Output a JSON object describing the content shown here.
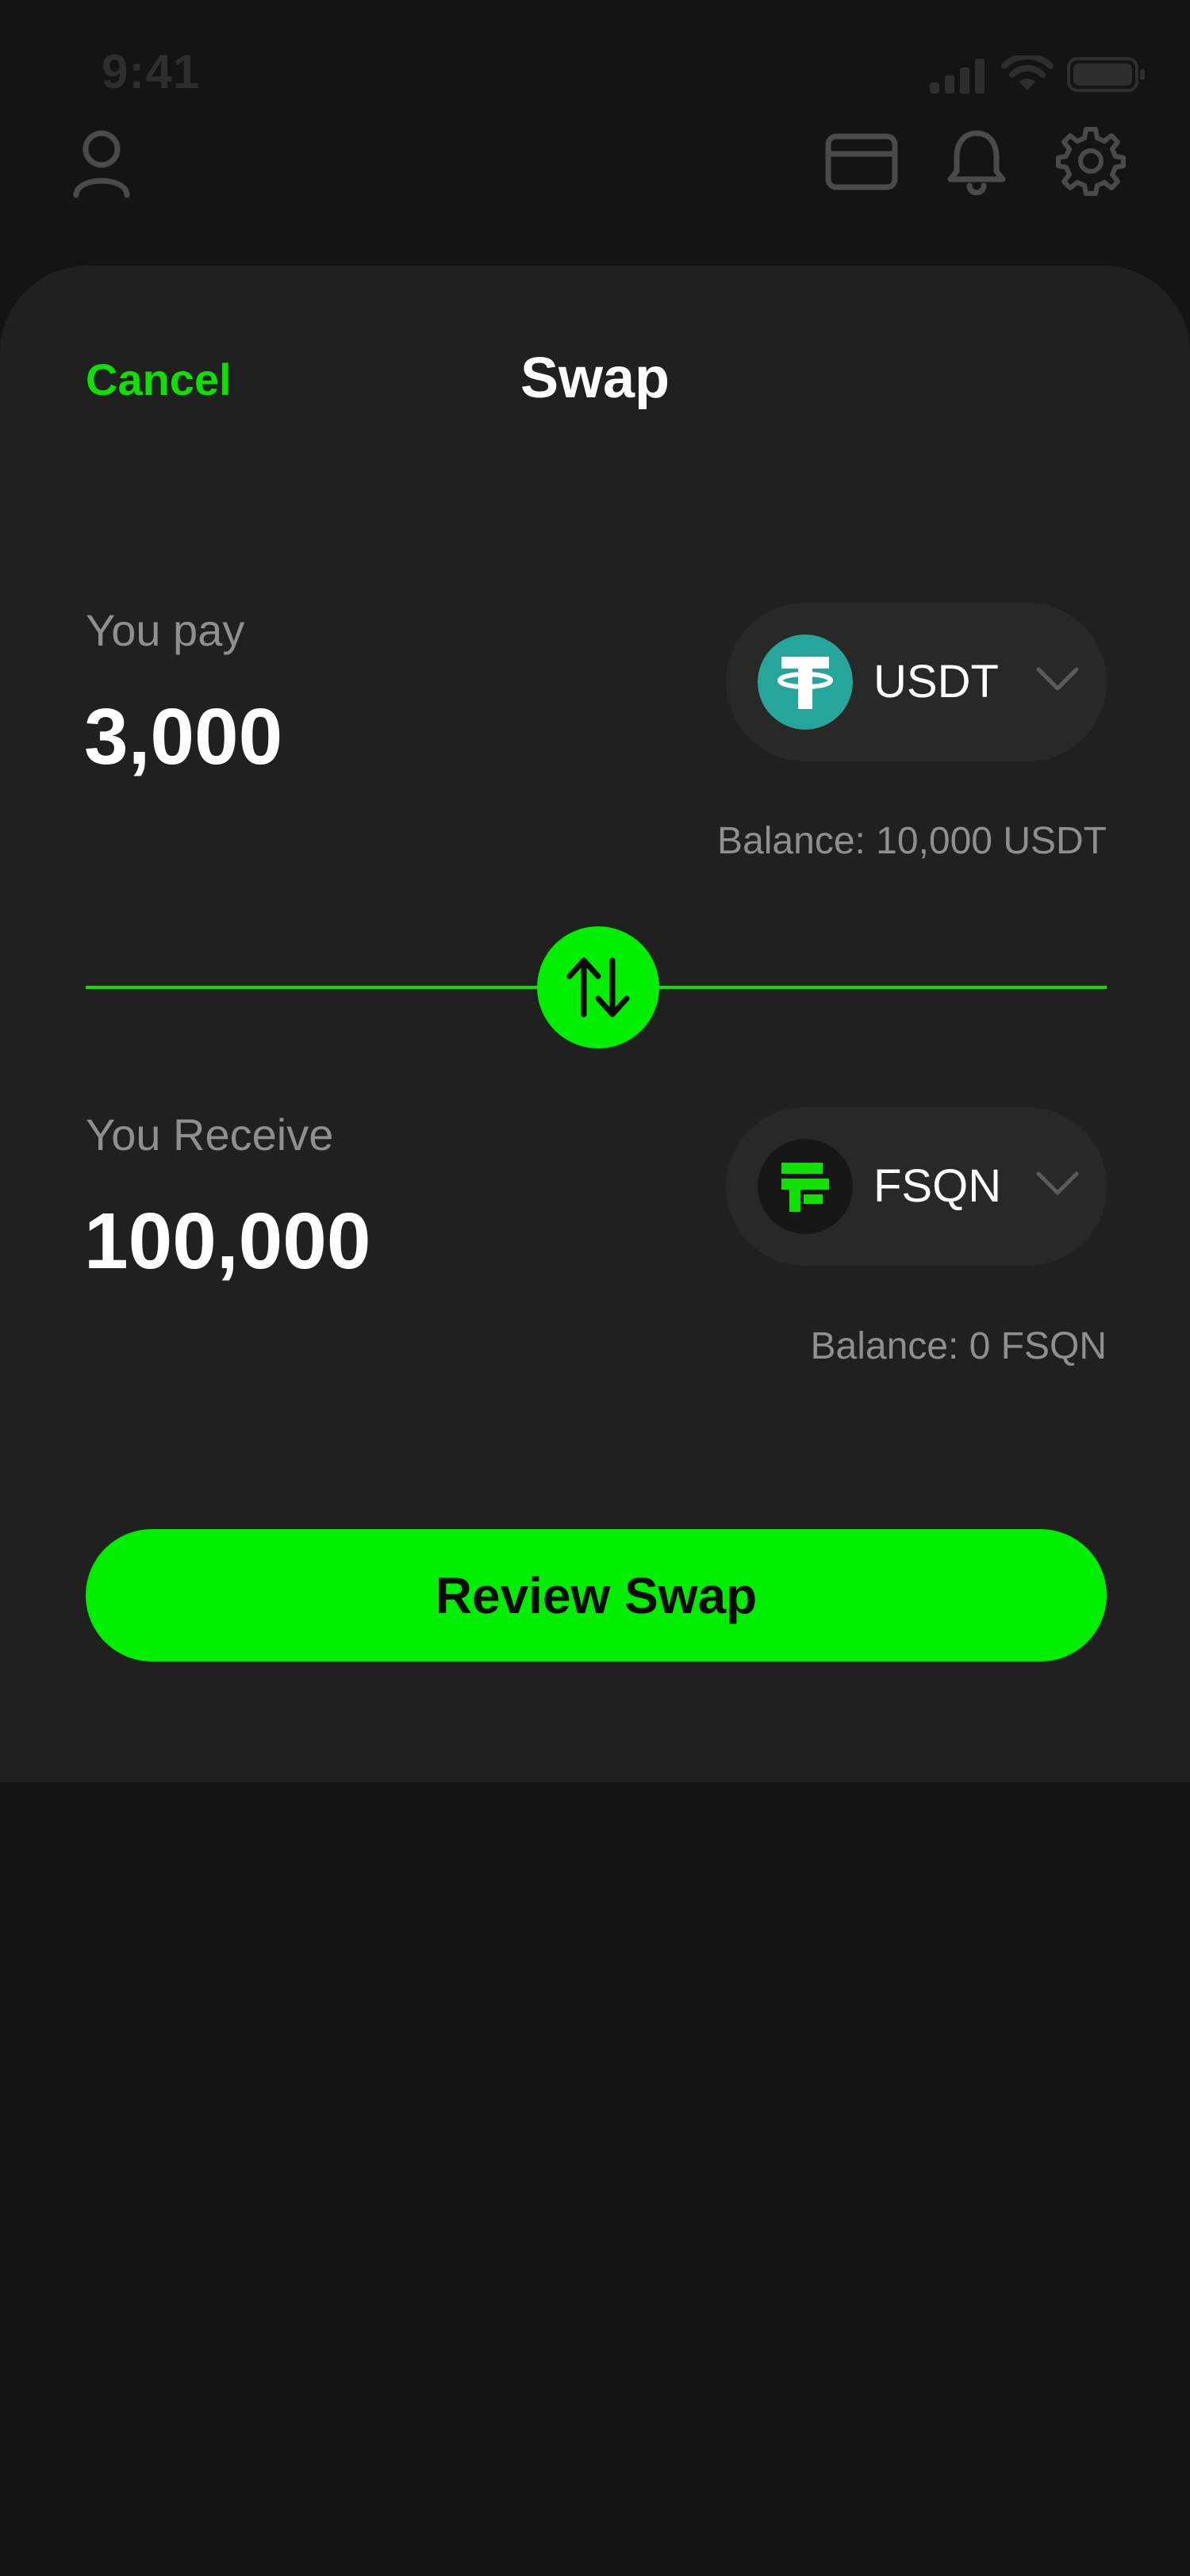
{
  "status_bar": {
    "time": "9:41",
    "icons": [
      "cellular-signal-icon",
      "wifi-icon",
      "battery-icon"
    ]
  },
  "top_bar": {
    "icons": [
      "user-icon",
      "card-icon",
      "bell-icon",
      "gear-icon"
    ]
  },
  "sheet": {
    "cancel_label": "Cancel",
    "title": "Swap"
  },
  "pay": {
    "label": "You pay",
    "amount": "3,000",
    "token": "USDT",
    "token_icon": "tether-logo-icon",
    "token_color": "#26a69a",
    "balance": "Balance: 10,000 USDT"
  },
  "receive": {
    "label": "You Receive",
    "amount": "100,000",
    "token": "FSQN",
    "token_icon": "fsqn-logo-icon",
    "token_color": "#10e000",
    "balance": "Balance: 0 FSQN"
  },
  "swap_direction_icon": "swap-arrows-icon",
  "review_button_label": "Review Swap",
  "colors": {
    "accent": "#00ee00",
    "background": "#141414",
    "sheet": "#202020",
    "muted_text": "#8f8f8f"
  }
}
